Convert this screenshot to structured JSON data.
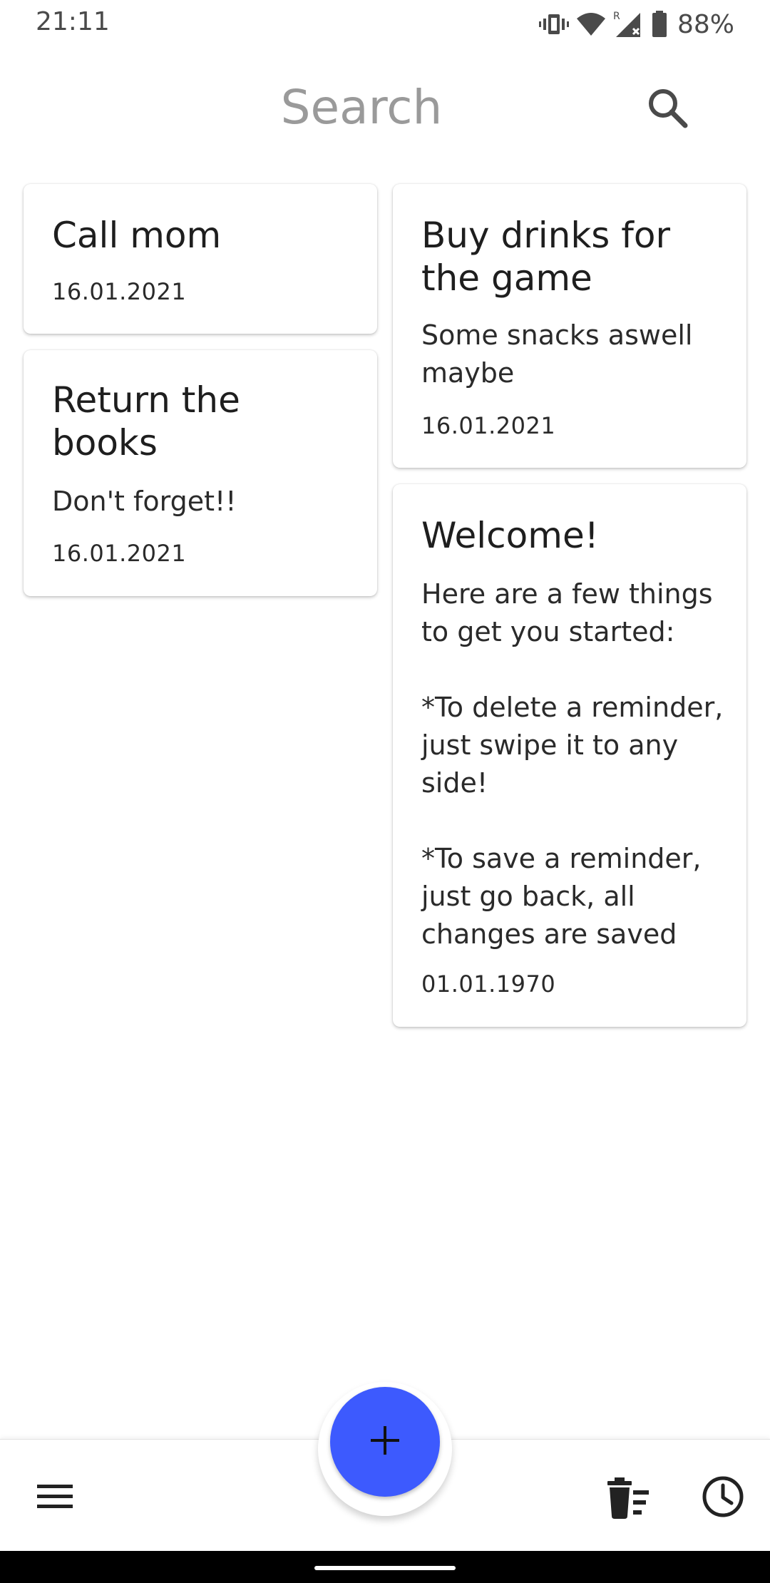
{
  "status_bar": {
    "time": "21:11",
    "battery_percent": "88%",
    "icons": [
      "vibrate-icon",
      "wifi-icon",
      "signal-roaming-icon",
      "battery-icon"
    ],
    "roaming_label": "R"
  },
  "header": {
    "search_label": "Search",
    "search_icon": "search-icon"
  },
  "reminders": [
    {
      "title": "Call mom",
      "body": "",
      "date": "16.01.2021"
    },
    {
      "title": "Buy drinks for the game",
      "body": "Some snacks aswell maybe",
      "date": "16.01.2021"
    },
    {
      "title": "Return the books",
      "body": "Don't forget!!",
      "date": "16.01.2021"
    },
    {
      "title": "Welcome!",
      "body": "Here are a few things to get you started:\n\n*To delete a reminder, just swipe it to any side!\n\n*To save a reminder, just go back, all changes are saved",
      "date": "01.01.1970"
    }
  ],
  "bottom_bar": {
    "menu_icon": "menu-icon",
    "add_icon": "plus-icon",
    "trash_icon": "delete-sweep-icon",
    "clock_icon": "clock-icon"
  },
  "colors": {
    "accent": "#3d5afe",
    "search_text": "#9a9a9a",
    "card_text": "#1e1e1e"
  }
}
